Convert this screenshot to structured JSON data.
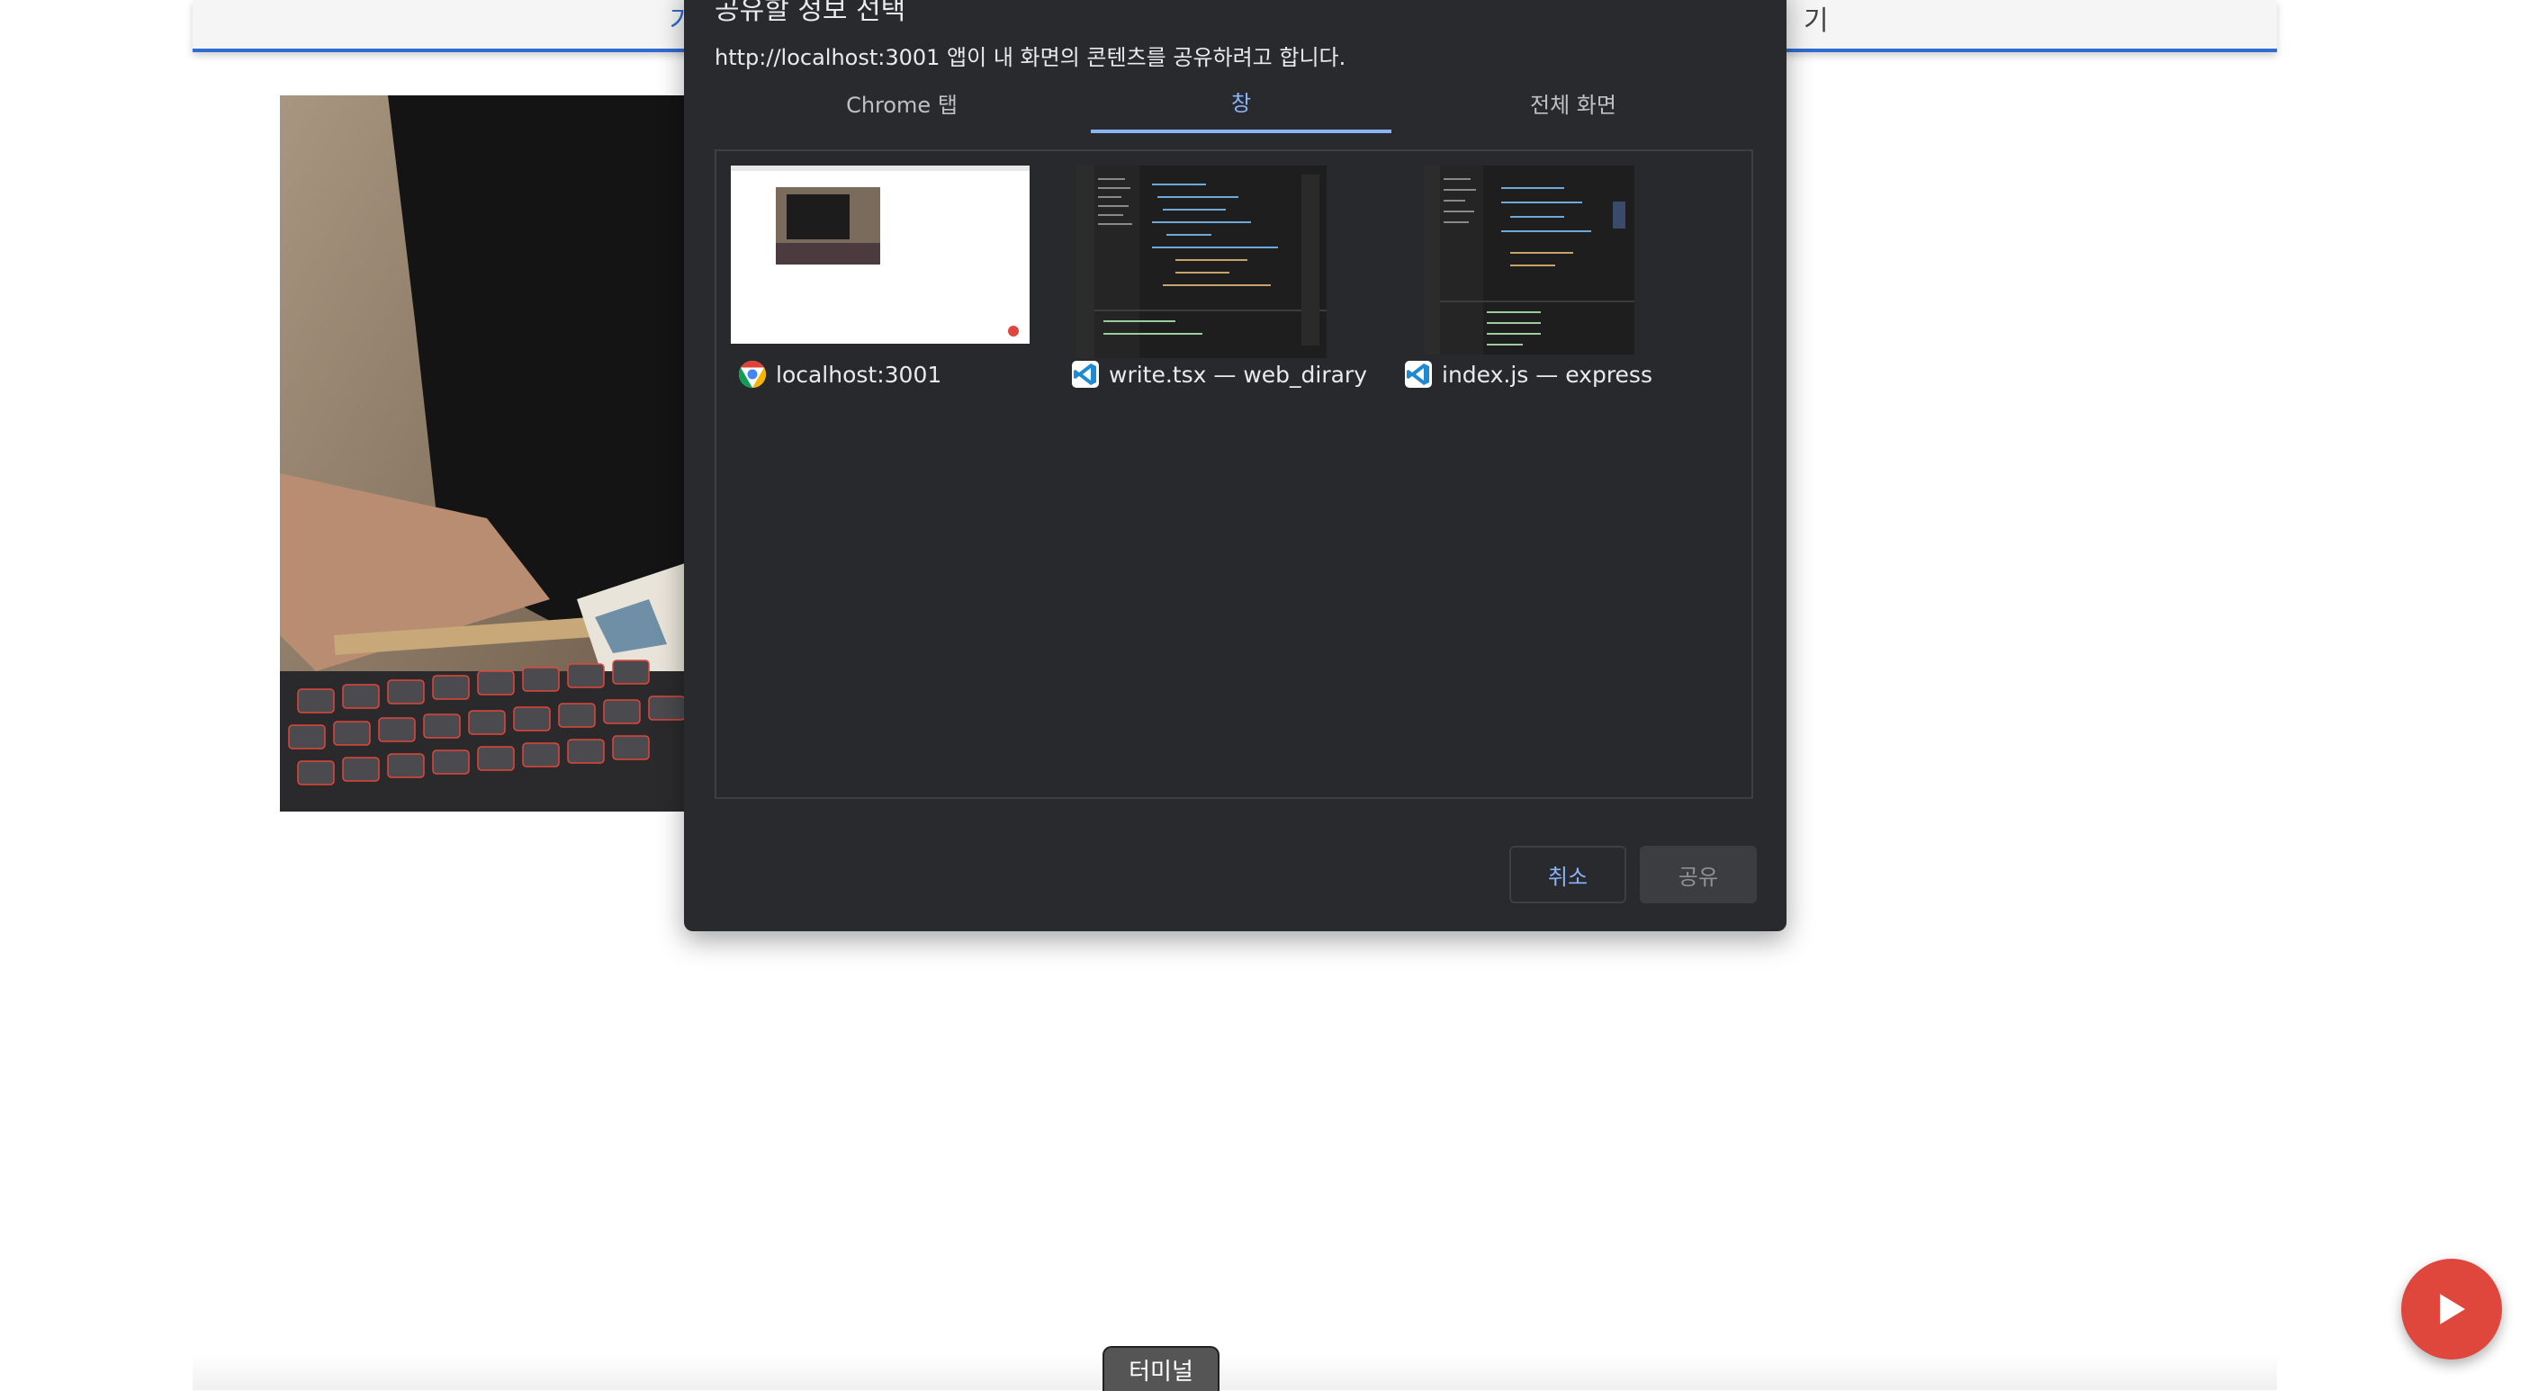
{
  "background_page": {
    "top_bar_fragments": [
      "가",
      "기"
    ],
    "terminal_tab_label": "터미널",
    "play_button_icon": "play-icon"
  },
  "dialog": {
    "title": "공유할 정보 선택",
    "subtitle": "http://localhost:3001 앱이 내 화면의 콘텐츠를 공유하려고 합니다.",
    "tabs": [
      {
        "label": "Chrome 탭",
        "active": false
      },
      {
        "label": "창",
        "active": true
      },
      {
        "label": "전체 화면",
        "active": false
      }
    ],
    "windows": [
      {
        "label": "localhost:3001",
        "app_icon": "chrome-icon"
      },
      {
        "label": "write.tsx — web_dirary",
        "app_icon": "vscode-icon"
      },
      {
        "label": "index.js — express",
        "app_icon": "vscode-icon"
      }
    ],
    "buttons": {
      "cancel": "취소",
      "share": "공유"
    }
  },
  "colors": {
    "dialog_bg": "#292a2d",
    "accent": "#8ab4f8",
    "fab_red": "#e0473c",
    "page_accent": "#2f6bd0"
  }
}
